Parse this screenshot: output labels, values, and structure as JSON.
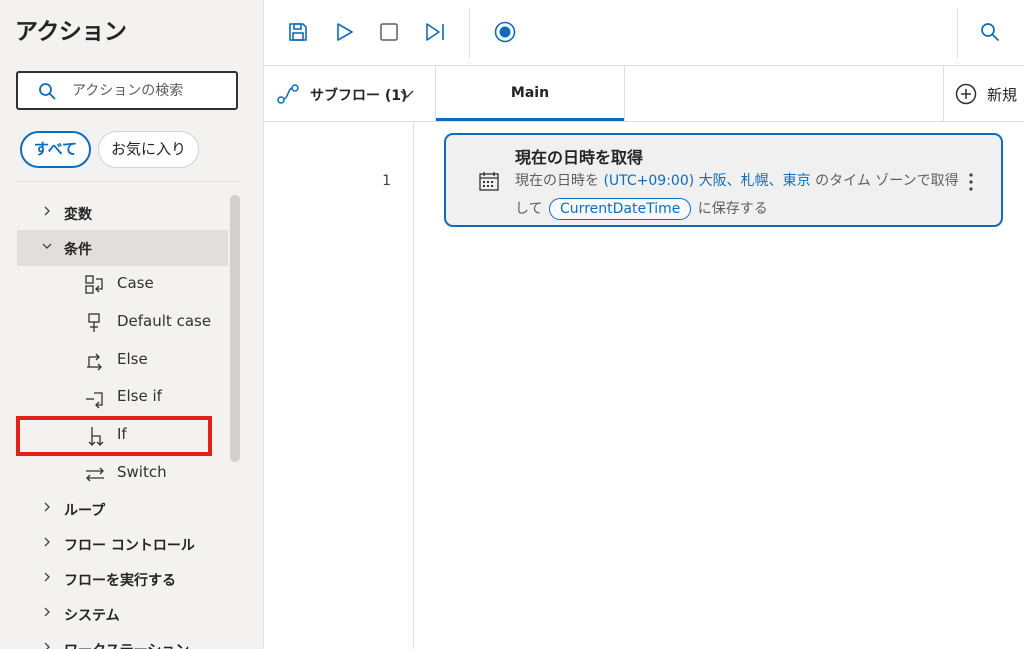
{
  "actions_pane": {
    "title": "アクション",
    "search": {
      "placeholder": "アクションの検索",
      "value": ""
    },
    "filters": {
      "all": "すべて",
      "favorites": "お気に入り"
    },
    "tree": {
      "variables": "変数",
      "conditionals": "条件",
      "conditional_items": [
        "Case",
        "Default case",
        "Else",
        "Else if",
        "If",
        "Switch"
      ],
      "loops": "ループ",
      "flow_control": "フロー コントロール",
      "run_flow": "フローを実行する",
      "system": "システム",
      "workstation": "ワークステーション"
    }
  },
  "toolbar": {
    "icons": [
      "save-icon",
      "run-icon",
      "stop-icon",
      "run-next-icon",
      "record-icon",
      "search-icon"
    ],
    "accent": "#0f6cbd"
  },
  "tabs": {
    "subflows_label": "サブフロー (1)",
    "main_label": "Main",
    "new_label": "新規"
  },
  "canvas": {
    "line_number": "1",
    "action": {
      "title": "現在の日時を取得",
      "line1_prefix": "現在の日時を ",
      "timezone": "(UTC+09:00) 大阪、札幌、東京",
      "line1_suffix": " のタイム ゾーンで取得",
      "line2_prefix": "して ",
      "variable": "CurrentDateTime",
      "line2_suffix": " に保存する"
    }
  },
  "colors": {
    "accent": "#0f6cbd",
    "highlight_box": "#e3211b"
  }
}
